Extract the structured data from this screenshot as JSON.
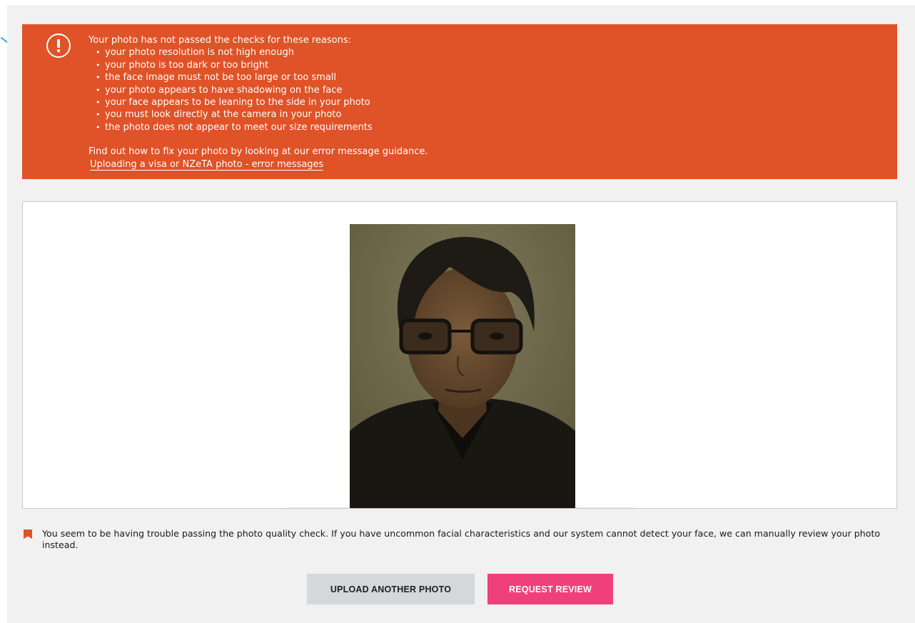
{
  "banner": {
    "intro": "Your photo has not passed the checks for these reasons:",
    "reasons": [
      "your photo resolution is not high enough",
      "your photo is too dark or too bright",
      "the face image must not be too large or too small",
      "your photo appears to have shadowing on the face",
      "your face appears to be leaning to the side in your photo",
      "you must look directly at the camera in your photo",
      "the photo does not appear to meet our size requirements"
    ],
    "fix_text": "Find out how to fix your photo by looking at our error message guidance.",
    "link_label": "Uploading a visa or NZeTA photo - error messages",
    "icon": "alert-circle-icon",
    "color": "#e05227"
  },
  "notice": {
    "text": "You seem to be having trouble passing the photo quality check. If you have uncommon facial characteristics and our system cannot detect your face, we can manually review your photo instead.",
    "icon": "flag-icon",
    "color": "#e05227"
  },
  "buttons": {
    "upload_label": "UPLOAD ANOTHER PHOTO",
    "review_label": "REQUEST REVIEW",
    "review_color": "#f0407c"
  }
}
